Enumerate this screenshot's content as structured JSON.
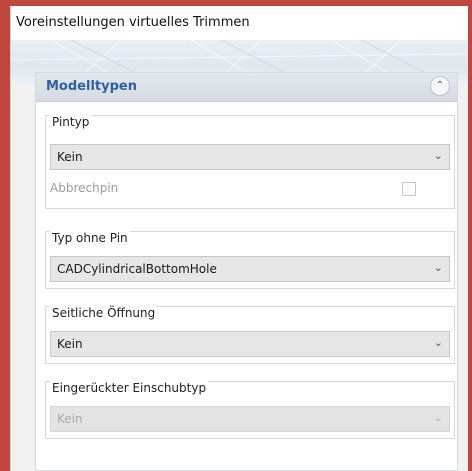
{
  "window": {
    "title": "Voreinstellungen virtuelles Trimmen"
  },
  "section": {
    "title": "Modelltypen",
    "collapse_icon": "chevron-double-up-icon"
  },
  "groups": {
    "pintyp": {
      "label": "Pintyp",
      "value": "Kein",
      "checkbox_label": "Abbrechpin",
      "checkbox_checked": false,
      "checkbox_enabled": false
    },
    "typ_ohne_pin": {
      "label": "Typ ohne Pin",
      "value": "CADCylindricalBottomHole"
    },
    "seitliche_oeffnung": {
      "label": "Seitliche Öffnung",
      "value": "Kein"
    },
    "einschubtyp": {
      "label": "Eingerückter Einschubtyp",
      "value": "Kein",
      "enabled": false
    }
  },
  "colors": {
    "section_title": "#2e5fa8",
    "background_red": "#c0473d",
    "panel": "#f1f1f1"
  }
}
